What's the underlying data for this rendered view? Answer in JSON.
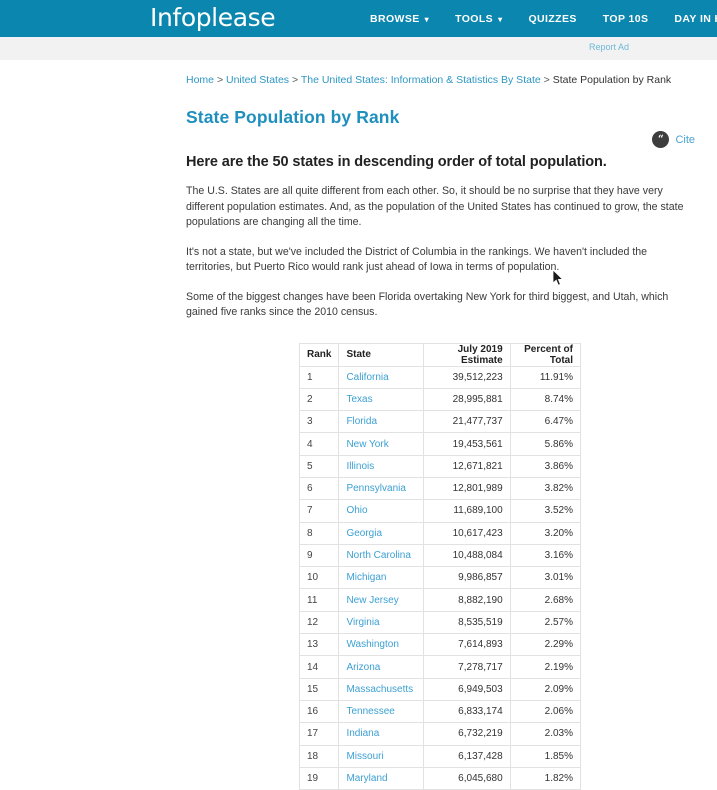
{
  "site": {
    "logo_text": "Infoplease",
    "header_color": "#0b86ae",
    "link_color": "#3ca0d3"
  },
  "nav": {
    "items": [
      {
        "label": "BROWSE",
        "caret": "▾"
      },
      {
        "label": "TOOLS",
        "caret": "▾"
      },
      {
        "label": "QUIZZES",
        "caret": ""
      },
      {
        "label": "TOP 10S",
        "caret": ""
      },
      {
        "label": "DAY IN HISTORY",
        "caret": ""
      }
    ]
  },
  "ad_strip": {
    "report_ad_label": "Report Ad"
  },
  "breadcrumb": {
    "items": [
      "Home",
      "United States",
      "The United States: Information & Statistics By State"
    ],
    "current": "State Population by Rank",
    "separator": ">"
  },
  "cite": {
    "label": "Cite",
    "icon_glyph": "“"
  },
  "page": {
    "title": "State Population by Rank",
    "subhead": "Here are the 50 states in descending order of total population.",
    "paragraphs": [
      "The U.S. States are all quite different from each other. So, it should be no surprise that they have very different population estimates. And, as the population of the United States has continued to grow, the state populations are changing all the time.",
      "It's not a state, but we've included the District of Columbia in the rankings. We haven't included the territories, but Puerto Rico would rank just ahead of Iowa in terms of population.",
      "Some of the biggest changes have been Florida overtaking New York for third biggest, and Utah, which gained five ranks since the 2010 census."
    ]
  },
  "table": {
    "columns": [
      "Rank",
      "State",
      "July 2019 Estimate",
      "Percent of Total"
    ],
    "rows": [
      {
        "rank": "1",
        "state": "California",
        "estimate": "39,512,223",
        "percent": "11.91%"
      },
      {
        "rank": "2",
        "state": "Texas",
        "estimate": "28,995,881",
        "percent": "8.74%"
      },
      {
        "rank": "3",
        "state": "Florida",
        "estimate": "21,477,737",
        "percent": "6.47%"
      },
      {
        "rank": "4",
        "state": "New York",
        "estimate": "19,453,561",
        "percent": "5.86%"
      },
      {
        "rank": "5",
        "state": "Illinois",
        "estimate": "12,671,821",
        "percent": "3.86%"
      },
      {
        "rank": "6",
        "state": "Pennsylvania",
        "estimate": "12,801,989",
        "percent": "3.82%"
      },
      {
        "rank": "7",
        "state": "Ohio",
        "estimate": "11,689,100",
        "percent": "3.52%"
      },
      {
        "rank": "8",
        "state": "Georgia",
        "estimate": "10,617,423",
        "percent": "3.20%"
      },
      {
        "rank": "9",
        "state": "North Carolina",
        "estimate": "10,488,084",
        "percent": "3.16%"
      },
      {
        "rank": "10",
        "state": "Michigan",
        "estimate": "9,986,857",
        "percent": "3.01%"
      },
      {
        "rank": "11",
        "state": "New Jersey",
        "estimate": "8,882,190",
        "percent": "2.68%"
      },
      {
        "rank": "12",
        "state": "Virginia",
        "estimate": "8,535,519",
        "percent": "2.57%"
      },
      {
        "rank": "13",
        "state": "Washington",
        "estimate": "7,614,893",
        "percent": "2.29%"
      },
      {
        "rank": "14",
        "state": "Arizona",
        "estimate": "7,278,717",
        "percent": "2.19%"
      },
      {
        "rank": "15",
        "state": "Massachusetts",
        "estimate": "6,949,503",
        "percent": "2.09%"
      },
      {
        "rank": "16",
        "state": "Tennessee",
        "estimate": "6,833,174",
        "percent": "2.06%"
      },
      {
        "rank": "17",
        "state": "Indiana",
        "estimate": "6,732,219",
        "percent": "2.03%"
      },
      {
        "rank": "18",
        "state": "Missouri",
        "estimate": "6,137,428",
        "percent": "1.85%"
      },
      {
        "rank": "19",
        "state": "Maryland",
        "estimate": "6,045,680",
        "percent": "1.82%"
      }
    ]
  }
}
